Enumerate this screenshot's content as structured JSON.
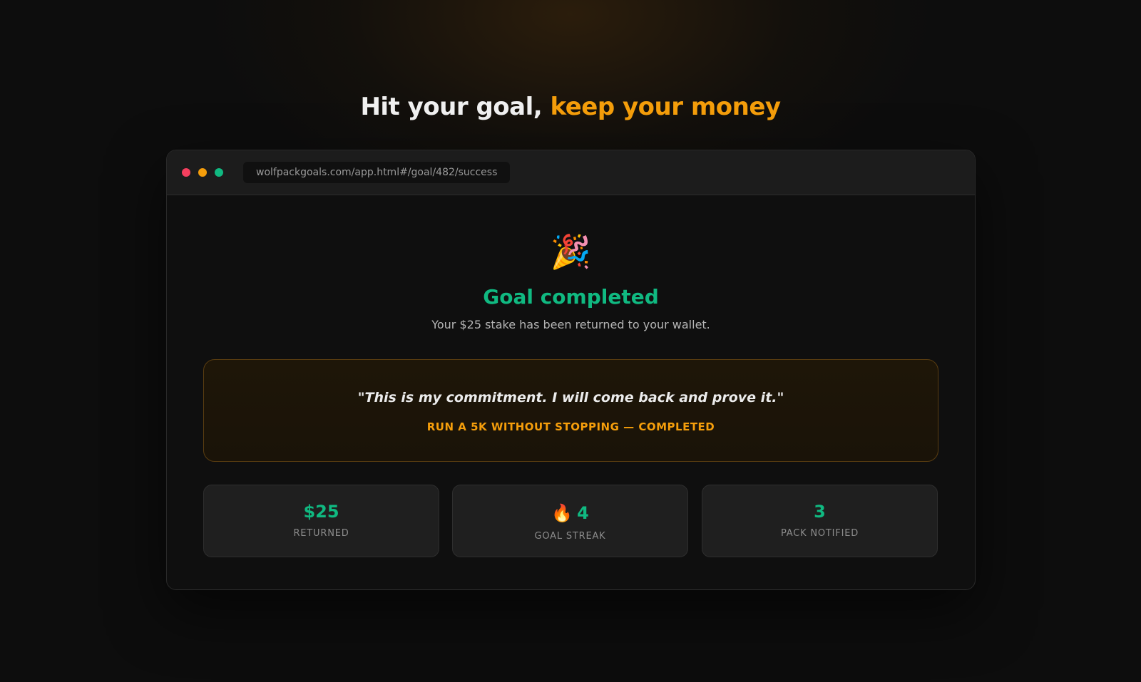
{
  "headline": {
    "text_plain": "Hit your goal, ",
    "text_accent": "keep your money"
  },
  "colors": {
    "accent": "#f59e0b",
    "success": "#10b981",
    "background": "#0d0d0d"
  },
  "browser": {
    "url": "wolfpackgoals.com/app.html#/goal/482/success"
  },
  "success": {
    "icon": "party-popper-icon",
    "title": "Goal completed",
    "subtitle": "Your $25 stake has been returned to your wallet."
  },
  "commitment": {
    "quote": "\"This is my commitment. I will come back and prove it.\"",
    "goal": "RUN A 5K WITHOUT STOPPING — COMPLETED"
  },
  "stats": [
    {
      "value": "$25",
      "label": "RETURNED"
    },
    {
      "icon": "fire-icon",
      "value": "4",
      "label": "GOAL STREAK"
    },
    {
      "value": "3",
      "label": "PACK NOTIFIED"
    }
  ]
}
